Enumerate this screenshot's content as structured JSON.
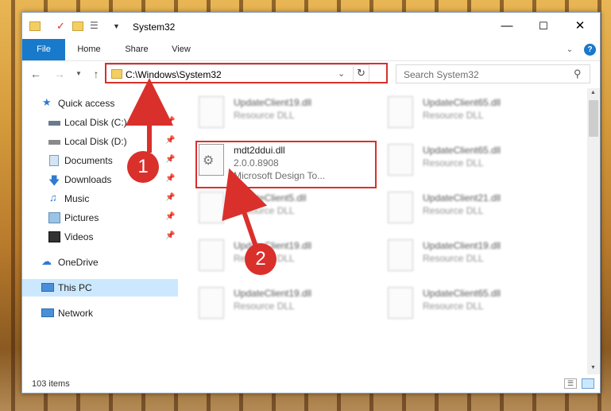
{
  "window": {
    "title": "System32"
  },
  "ribbon": {
    "tabs": [
      "File",
      "Home",
      "Share",
      "View"
    ]
  },
  "address": {
    "path": "C:\\Windows\\System32"
  },
  "search": {
    "placeholder": "Search System32"
  },
  "sidebar": {
    "items": [
      {
        "label": "Quick access",
        "icon": "star-icon"
      },
      {
        "label": "Local Disk (C:)",
        "icon": "drive-icon"
      },
      {
        "label": "Local Disk (D:)",
        "icon": "drive-icon"
      },
      {
        "label": "Documents",
        "icon": "documents-icon"
      },
      {
        "label": "Downloads",
        "icon": "download-icon"
      },
      {
        "label": "Music",
        "icon": "music-icon"
      },
      {
        "label": "Pictures",
        "icon": "pictures-icon"
      },
      {
        "label": "Videos",
        "icon": "videos-icon"
      },
      {
        "label": "OneDrive",
        "icon": "cloud-icon"
      },
      {
        "label": "This PC",
        "icon": "computer-icon"
      },
      {
        "label": "Network",
        "icon": "network-icon"
      }
    ]
  },
  "files": [
    {
      "name": "UpdateClient19.dll",
      "sub": "Resource DLL"
    },
    {
      "name": "UpdateClient65.dll",
      "sub": "Resource DLL"
    },
    {
      "name": "mdt2ddui.dll",
      "sub": "2.0.0.8908",
      "desc": "Microsoft Design To..."
    },
    {
      "name": "UpdateClient65.dll",
      "sub": "Resource DLL"
    },
    {
      "name": "UpdateClient5.dll",
      "sub": "Resource DLL"
    },
    {
      "name": "UpdateClient21.dll",
      "sub": "Resource DLL"
    },
    {
      "name": "UpdateClient19.dll",
      "sub": "Resource DLL"
    },
    {
      "name": "UpdateClient19.dll",
      "sub": "Resource DLL"
    },
    {
      "name": "UpdateClient19.dll",
      "sub": "Resource DLL"
    },
    {
      "name": "UpdateClient65.dll",
      "sub": "Resource DLL"
    }
  ],
  "status": {
    "count": "103 items"
  },
  "annotations": {
    "step1": "1",
    "step2": "2"
  },
  "colors": {
    "accent": "#1979ca",
    "highlight": "#d9302c",
    "selected": "#cce8ff"
  }
}
